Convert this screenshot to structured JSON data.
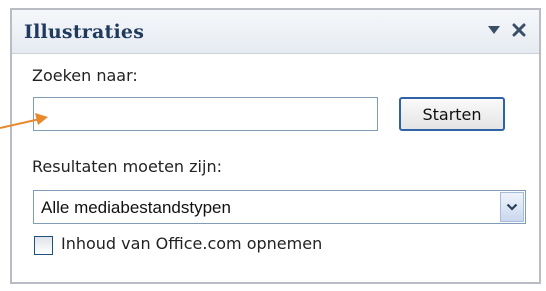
{
  "panel": {
    "title": "Illustraties",
    "menu_icon": "triangle-down-icon",
    "close_icon": "close-icon"
  },
  "search": {
    "label": "Zoeken naar:",
    "value": "",
    "button_label": "Starten"
  },
  "results": {
    "label": "Resultaten moeten zijn:",
    "selected": "Alle mediabestandstypen",
    "dropdown_icon": "chevron-down-icon"
  },
  "options": {
    "include_office_label": "Inhoud van Office.com opnemen",
    "include_office_checked": false
  },
  "annotation": {
    "arrow_icon": "arrow-right-icon",
    "arrow_color": "#e8892d"
  },
  "colors": {
    "title": "#1f3a5c",
    "focus_border": "#2f62a6",
    "input_border": "#7f9db9"
  }
}
